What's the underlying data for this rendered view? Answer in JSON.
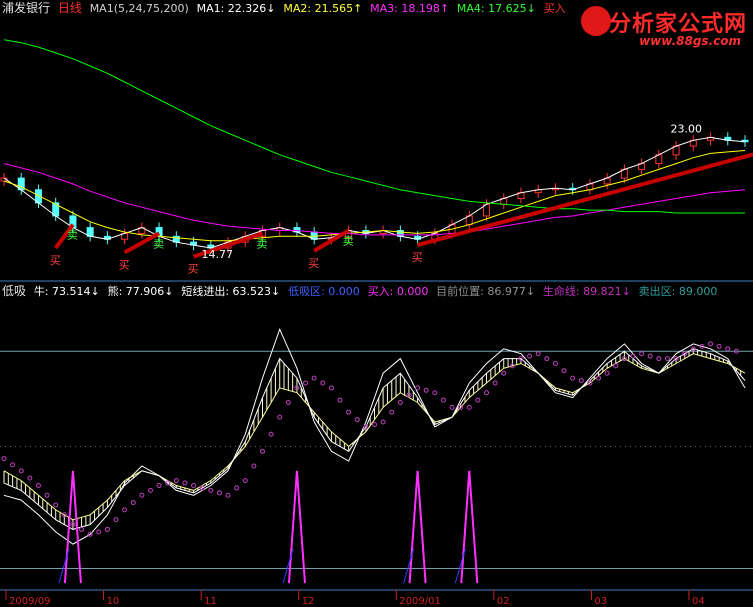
{
  "top_header": {
    "stock_name": "浦发银行",
    "period": "日线",
    "ma_params": "MA1(5,24,75,200)",
    "ma1": "MA1: 22.326↓",
    "ma2": "MA2: 21.565↑",
    "ma3": "MA3: 18.198↑",
    "ma4": "MA4: 17.625↓",
    "signal": "买入"
  },
  "logo": {
    "title": "分析家公式网",
    "url": "www.88gs.com"
  },
  "indicator_header": {
    "name": "低吸",
    "niu": "牛: 73.514↓",
    "xiong": "熊: 77.906↓",
    "short": "短线进出: 63.523↓",
    "low_zone": "低吸区: 0.000",
    "buy": "买入: 0.000",
    "position": "目前位置: 86.977↓",
    "life": "生命线: 89.821↓",
    "sell_zone": "卖出区: 89.000"
  },
  "markers": {
    "sell": "卖",
    "buy": "买"
  },
  "price_labels": {
    "high": "23.00",
    "low": "14.77"
  },
  "x_axis": {
    "labels": [
      "2009/09",
      "10",
      "11",
      "12",
      "2009/01",
      "02",
      "03",
      "04"
    ]
  },
  "colors": {
    "up": "#ff3232",
    "down": "#54ffff",
    "ma1": "#ffffff",
    "ma2": "#ffff00",
    "ma3": "#ff00ff",
    "ma4": "#00ff00",
    "trend": "#c80000",
    "grid": "#4080c0"
  },
  "chart_data": [
    {
      "type": "candlestick",
      "series": [
        {
          "name": "MA1",
          "values": [
            20.0,
            19.2,
            18.3,
            17.4,
            16.6,
            16.0,
            15.8,
            16.2,
            16.6,
            16.0,
            15.6,
            15.4,
            15.2,
            15.6,
            16.0,
            16.4,
            16.6,
            16.3,
            15.8,
            15.9,
            16.4,
            16.2,
            16.4,
            16.0,
            15.8,
            16.2,
            16.8,
            17.4,
            18.2,
            18.6,
            19.0,
            19.2,
            19.3,
            19.2,
            19.6,
            20.0,
            20.6,
            21.0,
            21.6,
            22.2,
            22.6,
            22.8,
            22.6,
            22.5
          ]
        },
        {
          "name": "MA2",
          "values": [
            19.8,
            19.4,
            18.8,
            18.2,
            17.6,
            17.0,
            16.6,
            16.3,
            16.1,
            16.0,
            15.9,
            15.8,
            15.7,
            15.7,
            15.8,
            15.9,
            16.0,
            16.0,
            16.0,
            16.1,
            16.2,
            16.3,
            16.4,
            16.3,
            16.2,
            16.3,
            16.5,
            16.8,
            17.2,
            17.6,
            18.0,
            18.4,
            18.8,
            19.0,
            19.2,
            19.5,
            19.8,
            20.2,
            20.6,
            21.0,
            21.4,
            21.7,
            21.8,
            21.9
          ]
        },
        {
          "name": "MA3",
          "values": [
            21.0,
            20.7,
            20.4,
            20.0,
            19.6,
            19.1,
            18.7,
            18.3,
            18.0,
            17.7,
            17.4,
            17.1,
            16.9,
            16.7,
            16.6,
            16.5,
            16.4,
            16.4,
            16.3,
            16.2,
            16.2,
            16.1,
            16.1,
            16.1,
            16.1,
            16.1,
            16.2,
            16.3,
            16.5,
            16.7,
            16.9,
            17.1,
            17.3,
            17.4,
            17.6,
            17.8,
            18.0,
            18.2,
            18.4,
            18.6,
            18.8,
            19.0,
            19.1,
            19.2
          ]
        },
        {
          "name": "MA4",
          "values": [
            29.5,
            29.3,
            29.0,
            28.6,
            28.2,
            27.7,
            27.2,
            26.6,
            26.0,
            25.4,
            24.8,
            24.2,
            23.6,
            23.1,
            22.6,
            22.1,
            21.6,
            21.2,
            20.8,
            20.4,
            20.1,
            19.8,
            19.5,
            19.2,
            19.0,
            18.8,
            18.6,
            18.4,
            18.3,
            18.2,
            18.1,
            18.0,
            17.9,
            17.9,
            17.8,
            17.8,
            17.7,
            17.7,
            17.7,
            17.6,
            17.6,
            17.6,
            17.6,
            17.6
          ]
        }
      ],
      "trend_lines": [
        [
          [
            3,
            15.2
          ],
          [
            4,
            16.8
          ]
        ],
        [
          [
            7,
            14.9
          ],
          [
            9,
            16.2
          ]
        ],
        [
          [
            11,
            14.6
          ],
          [
            15,
            16.2
          ]
        ],
        [
          [
            18,
            15.0
          ],
          [
            20,
            16.4
          ]
        ],
        [
          [
            24,
            15.4
          ],
          [
            44,
            21.8
          ]
        ]
      ],
      "title": "",
      "xlabel": "",
      "ylabel": ""
    },
    {
      "type": "line",
      "ylim": [
        0,
        100
      ],
      "series": [
        {
          "name": "牛",
          "values": [
            30,
            28,
            22,
            15,
            10,
            14,
            22,
            35,
            42,
            38,
            32,
            30,
            34,
            40,
            55,
            78,
            98,
            82,
            60,
            48,
            44,
            60,
            80,
            86,
            72,
            58,
            62,
            76,
            84,
            90,
            88,
            80,
            72,
            70,
            78,
            86,
            92,
            84,
            80,
            88,
            92,
            90,
            86,
            74
          ]
        },
        {
          "name": "熊",
          "values": [
            40,
            36,
            30,
            24,
            20,
            22,
            28,
            36,
            40,
            38,
            34,
            32,
            36,
            42,
            50,
            62,
            74,
            72,
            64,
            56,
            50,
            56,
            66,
            72,
            68,
            60,
            62,
            70,
            76,
            82,
            84,
            80,
            74,
            72,
            76,
            82,
            86,
            82,
            80,
            84,
            88,
            86,
            84,
            80
          ]
        },
        {
          "name": "短线进出",
          "values": [
            35,
            32,
            26,
            20,
            16,
            18,
            25,
            34,
            40,
            38,
            33,
            31,
            35,
            41,
            52,
            70,
            86,
            78,
            62,
            52,
            48,
            58,
            74,
            80,
            70,
            59,
            62,
            73,
            80,
            86,
            86,
            80,
            73,
            71,
            77,
            84,
            89,
            83,
            80,
            86,
            90,
            88,
            85,
            77
          ]
        },
        {
          "name": "生命线",
          "values": [
            45,
            40,
            34,
            26,
            18,
            14,
            16,
            24,
            30,
            34,
            36,
            34,
            32,
            30,
            36,
            48,
            62,
            74,
            78,
            74,
            64,
            58,
            60,
            68,
            74,
            72,
            66,
            66,
            72,
            80,
            86,
            88,
            84,
            78,
            76,
            80,
            86,
            88,
            86,
            86,
            90,
            92,
            90,
            88
          ]
        }
      ],
      "levels": {
        "卖出区": 89.0,
        "低吸区": 0.0
      },
      "spikes": [
        4,
        17,
        24,
        27
      ],
      "title": "",
      "xlabel": "",
      "ylabel": ""
    }
  ]
}
